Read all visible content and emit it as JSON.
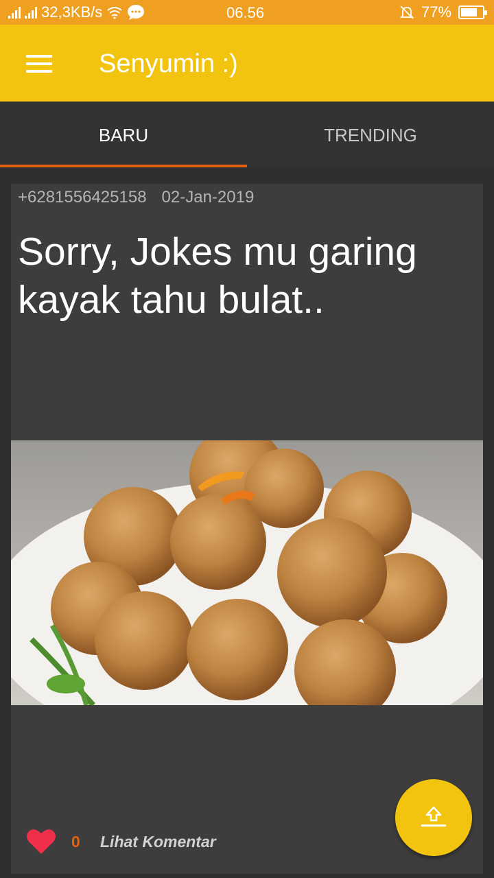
{
  "status_bar": {
    "network_speed": "32,3KB/s",
    "time": "06.56",
    "battery": "77%",
    "battery_level": 0.77,
    "icons": [
      "signal-icon",
      "wifi-icon",
      "chat-bubble-icon",
      "mute-icon",
      "battery-icon"
    ]
  },
  "app_bar": {
    "title": "Senyumin :)"
  },
  "tabs": [
    {
      "label": "BARU",
      "selected": true
    },
    {
      "label": "TRENDING",
      "selected": false
    }
  ],
  "post": {
    "author": "+6281556425158",
    "date": "02-Jan-2019",
    "text": "Sorry, Jokes mu garing kayak tahu bulat..",
    "image_subject": "tahu-bulat-photo",
    "like_count": "0",
    "comment_link": "Lihat Komentar"
  },
  "colors": {
    "status_bar": "#f0a020",
    "app_bar": "#f2c40f",
    "accent": "#e3600f",
    "background": "#2f2f2f",
    "card": "#3d3d3d",
    "like": "#f0304a"
  }
}
